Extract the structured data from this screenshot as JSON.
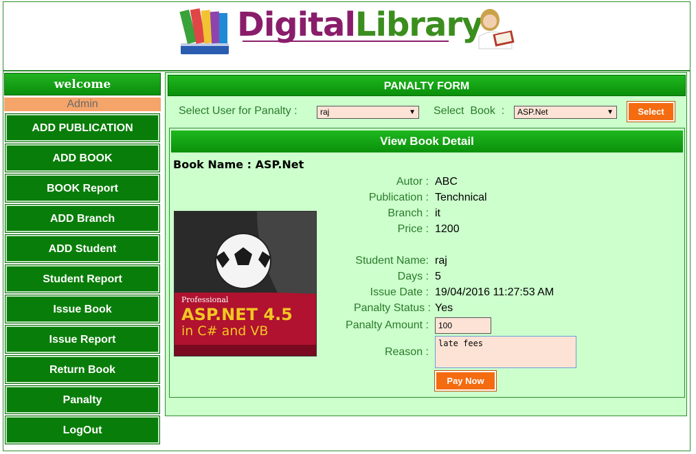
{
  "header": {
    "brand_part1": "Digital",
    "brand_part2": "Library"
  },
  "sidebar": {
    "welcome": "welcome",
    "role": "Admin",
    "items": [
      {
        "label": "ADD PUBLICATION"
      },
      {
        "label": "ADD BOOK"
      },
      {
        "label": "BOOK Report"
      },
      {
        "label": "ADD Branch"
      },
      {
        "label": "ADD Student"
      },
      {
        "label": "Student Report"
      },
      {
        "label": "Issue Book"
      },
      {
        "label": "Issue Report"
      },
      {
        "label": "Return Book"
      },
      {
        "label": "Panalty"
      },
      {
        "label": "LogOut"
      }
    ]
  },
  "form": {
    "title": "PANALTY FORM",
    "user_label": "Select User for Panalty :",
    "user_value": "raj",
    "book_label": "Select  Book  :",
    "book_value": "ASP.Net",
    "select_button": "Select"
  },
  "detail": {
    "title": "View Book Detail",
    "book_name": "Book Name : ASP.Net",
    "cover": {
      "line1": "Professional",
      "line2": "ASP.NET 4.5",
      "line3": "in C# and VB"
    },
    "fields": [
      {
        "label": "Autor :",
        "value": "ABC"
      },
      {
        "label": "Publication :",
        "value": "Tenchnical"
      },
      {
        "label": "Branch :",
        "value": "it"
      },
      {
        "label": "Price :",
        "value": "1200"
      },
      {
        "label": "Student Name:",
        "value": "raj"
      },
      {
        "label": "Days :",
        "value": "5"
      },
      {
        "label": "Issue Date :",
        "value": "19/04/2016 11:27:53 AM"
      },
      {
        "label": "Panalty Status :",
        "value": "Yes"
      }
    ],
    "amount_label": "Panalty Amount :",
    "amount_value": "100",
    "reason_label": "Reason :",
    "reason_value": "late fees",
    "pay_button": "Pay Now"
  },
  "colors": {
    "green": "#097d09",
    "light_green": "#ccffcc",
    "orange": "#f46b10",
    "input_bg": "#fde3d6"
  }
}
